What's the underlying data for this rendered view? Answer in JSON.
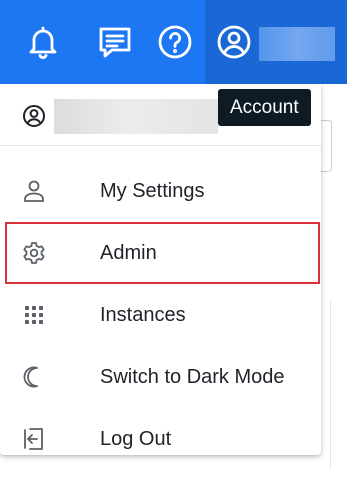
{
  "topbar": {
    "icons": [
      "bell-icon",
      "chat-icon",
      "help-icon",
      "account-circle-icon"
    ],
    "accent_color": "#1e77f2"
  },
  "tooltip": {
    "text": "Account"
  },
  "menu": {
    "user_icon": "account-circle-icon",
    "items": [
      {
        "label": "My Settings",
        "icon": "person-icon"
      },
      {
        "label": "Admin",
        "icon": "gear-icon",
        "highlighted": true
      },
      {
        "label": "Instances",
        "icon": "grid-dots-icon"
      },
      {
        "label": "Switch to Dark Mode",
        "icon": "moon-icon"
      },
      {
        "label": "Log Out",
        "icon": "logout-icon"
      }
    ],
    "highlight_color": "#d8323c"
  }
}
